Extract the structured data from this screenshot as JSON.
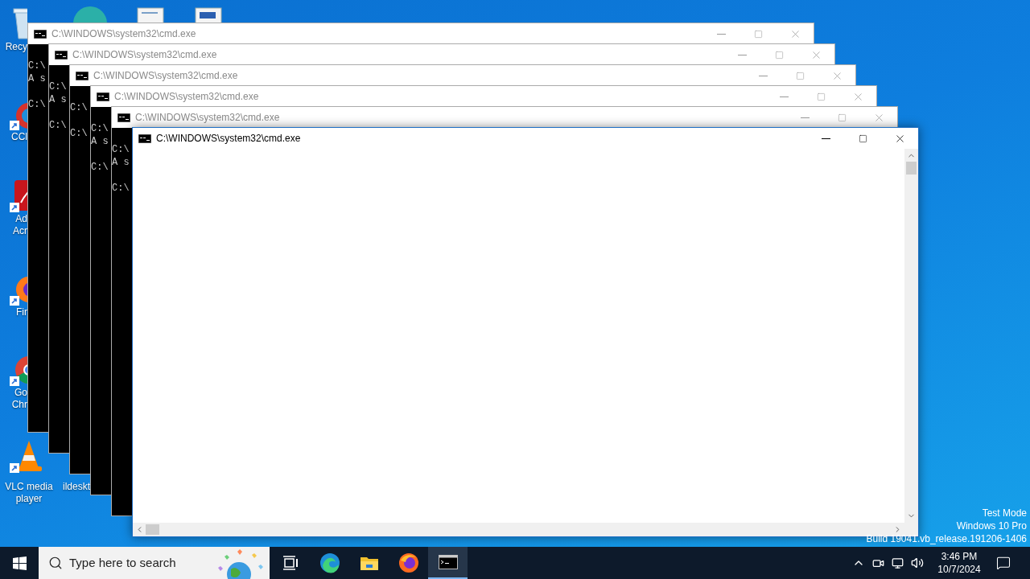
{
  "desktop": {
    "icons": [
      {
        "kind": "recycle",
        "label": [
          "Recy"
        ]
      },
      {
        "kind": "ccleaner",
        "label": [
          "CCl"
        ]
      },
      {
        "kind": "acrobat",
        "label": [
          "Ad",
          "Acr"
        ]
      },
      {
        "kind": "firefox",
        "label": [
          "Fir"
        ]
      },
      {
        "kind": "chrome",
        "label": [
          "Go",
          "Chr"
        ]
      },
      {
        "kind": "vlc",
        "label": [
          "VLC media",
          "player"
        ]
      },
      {
        "kind": "blank",
        "label": [
          "ildeskt"
        ]
      }
    ],
    "system_text": [
      "Test Mode",
      "Windows 10 Pro",
      "Build 19041.vb_release.191206-1406"
    ]
  },
  "windows": [
    {
      "title": "C:\\WINDOWS\\system32\\cmd.exe",
      "active": false,
      "blocks": [
        [
          "C:\\",
          "A s"
        ],
        [
          "C:\\"
        ]
      ]
    },
    {
      "title": "C:\\WINDOWS\\system32\\cmd.exe",
      "active": false,
      "blocks": [
        [
          "C:\\",
          "A s"
        ],
        [
          "C:\\"
        ]
      ]
    },
    {
      "title": "C:\\WINDOWS\\system32\\cmd.exe",
      "active": false,
      "blocks": [
        [
          "C:\\"
        ],
        [
          "C:\\"
        ]
      ]
    },
    {
      "title": "C:\\WINDOWS\\system32\\cmd.exe",
      "active": false,
      "blocks": [
        [
          "C:\\",
          "A s"
        ],
        [
          "C:\\"
        ]
      ]
    },
    {
      "title": "C:\\WINDOWS\\system32\\cmd.exe",
      "active": false,
      "blocks": [
        [
          "C:\\",
          "A s"
        ],
        [
          "C:\\"
        ]
      ]
    },
    {
      "title": "C:\\WINDOWS\\system32\\cmd.exe",
      "active": true
    }
  ],
  "taskbar": {
    "search": {
      "placeholder": "Type here to search"
    },
    "apps": [
      {
        "kind": "taskview",
        "active": false
      },
      {
        "kind": "edge",
        "active": false
      },
      {
        "kind": "explorer",
        "active": false
      },
      {
        "kind": "firefox",
        "active": false
      },
      {
        "kind": "cmd",
        "active": true
      }
    ],
    "clock": {
      "time": "3:46 PM",
      "date": "10/7/2024"
    }
  }
}
